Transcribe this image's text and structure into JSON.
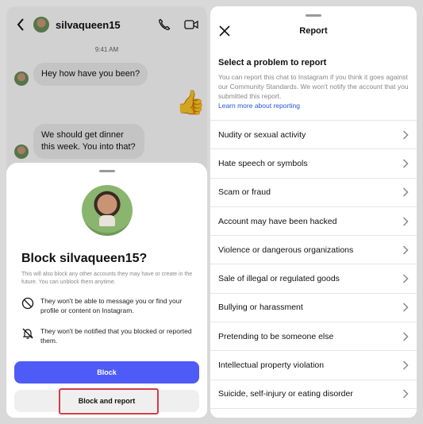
{
  "colors": {
    "primary": "#4e5bf7",
    "highlight": "#d33b48",
    "link": "#2255d6"
  },
  "chat": {
    "username": "silvaqueen15",
    "time": "9:41 AM",
    "messages": [
      "Hey how have you been?",
      "We should get dinner this week. You into that?"
    ],
    "reaction": "👍"
  },
  "block_sheet": {
    "title": "Block silvaqueen15?",
    "description": "This will also block any other accounts they may have or create in the future. You can unblock them anytime.",
    "info": [
      {
        "icon": "blocked-message-icon",
        "text": "They won't be able to message you or find your profile or content on Instagram."
      },
      {
        "icon": "bell-off-icon",
        "text": "They won't be notified that you blocked or reported them."
      }
    ],
    "block_label": "Block",
    "block_report_label": "Block and report"
  },
  "report": {
    "title": "Report",
    "heading": "Select a problem to report",
    "description": "You can report this chat to Instagram if you think it goes against our Community Standards. We won't notify the account that you submitted this report.",
    "link": "Learn more about reporting",
    "options": [
      "Nudity or sexual activity",
      "Hate speech or symbols",
      "Scam or fraud",
      "Account may have been hacked",
      "Violence or dangerous organizations",
      "Sale of illegal or regulated goods",
      "Bullying or harassment",
      "Pretending to be someone else",
      "Intellectual property violation",
      "Suicide, self-injury or eating disorder"
    ]
  }
}
